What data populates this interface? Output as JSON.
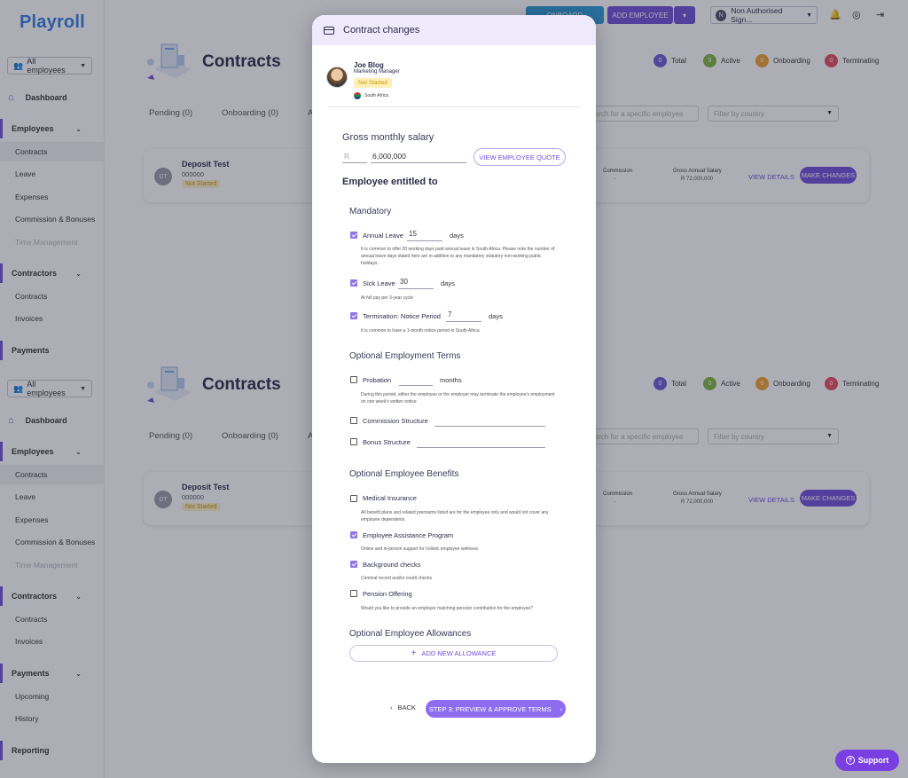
{
  "app": {
    "logo": "Playroll"
  },
  "topbar": {
    "btn1": "ONBOARD",
    "add_employee": "ADD EMPLOYEE",
    "account_badge": "N",
    "account": "Non Authorised Sign..."
  },
  "sidebar": {
    "filter": "All employees",
    "dashboard": "Dashboard",
    "employees": "Employees",
    "employee_items": [
      "Contracts",
      "Leave",
      "Expenses",
      "Commission & Bonuses",
      "Time Management"
    ],
    "contractors": "Contractors",
    "contractor_items": [
      "Contracts",
      "Invoices"
    ],
    "payments": "Payments",
    "payment_items": [
      "Upcoming",
      "History"
    ],
    "reporting": "Reporting"
  },
  "page": {
    "title": "Contracts",
    "stats": [
      {
        "count": "0",
        "label": "Total",
        "color": "#6a5bd6"
      },
      {
        "count": "0",
        "label": "Active",
        "color": "#7cb342"
      },
      {
        "count": "0",
        "label": "Onboarding",
        "color": "#f0a030"
      },
      {
        "count": "0",
        "label": "Terminating",
        "color": "#e54b5e"
      }
    ],
    "tabs": [
      "Pending (0)",
      "Onboarding (0)",
      "A"
    ],
    "search_placeholder": "Search for a specific employee",
    "country_placeholder": "Filter by country",
    "row": {
      "initials": "DT",
      "name": "Deposit Test",
      "id": "000000",
      "status": "Not Started",
      "commission_label": "Commission",
      "commission_value": "-",
      "gross_label": "Gross Annual Salary",
      "gross_value": "R 72,000,000",
      "view_details": "VIEW DETAILS",
      "make_changes": "MAKE CHANGES"
    }
  },
  "modal": {
    "title": "Contract changes",
    "employee": {
      "name": "Joe Blog",
      "role": "Marketing Manager",
      "status": "Not Started",
      "country": "South Africa"
    },
    "salary_label": "Gross monthly salary",
    "currency": "R",
    "salary_value": "6,000,000",
    "quote_button": "VIEW EMPLOYEE QUOTE",
    "entitled_heading": "Employee entitled to",
    "mandatory_heading": "Mandatory",
    "mandatory": [
      {
        "label": "Annual Leave",
        "value": "15",
        "unit": "days",
        "checked": true,
        "hint": "It is common to offer 20 working days paid annual leave in South Africa. Please note the number of annual leave days stated here are in addition to any mandatory statutory non-working public holidays."
      },
      {
        "label": "Sick Leave",
        "value": "30",
        "unit": "days",
        "checked": true,
        "hint": "At full pay per 3-year cycle"
      },
      {
        "label": "Termination: Notice Period",
        "value": "7",
        "unit": "days",
        "checked": true,
        "hint": "It is common to have a 1-month notice period in South Africa"
      }
    ],
    "optional_terms_heading": "Optional Employment Terms",
    "optional_terms": [
      {
        "label": "Probation",
        "unit": "months",
        "checked": false,
        "hint": "During this period, either the employee or the employer may terminate the employee's employment on one week's written notice"
      },
      {
        "label": "Commission Structure",
        "checked": false
      },
      {
        "label": "Bonus Structure",
        "checked": false
      }
    ],
    "benefits_heading": "Optional Employee Benefits",
    "benefits": [
      {
        "label": "Medical Insurance",
        "checked": false,
        "hint": "All benefit plans and related premiums listed are for the employee only and would not cover any employee dependents"
      },
      {
        "label": "Employee Assistance Program",
        "checked": true,
        "hint": "Online and in-person support for holistic employee wellness"
      },
      {
        "label": "Background checks",
        "checked": true,
        "hint": "Criminal record and/or credit checks"
      },
      {
        "label": "Pension Offering",
        "checked": false,
        "hint": "Would you like to provide an employer matching pension contribution for the employee?"
      }
    ],
    "allowances_heading": "Optional Employee Allowances",
    "add_allowance": "ADD NEW ALLOWANCE",
    "back": "BACK",
    "next": "STEP 3: PREVIEW & APPROVE TERMS"
  },
  "support": "Support"
}
